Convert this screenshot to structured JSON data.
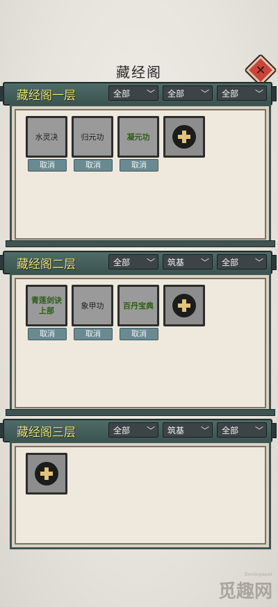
{
  "title": "藏经阁",
  "floors": [
    {
      "name": "藏经阁一层",
      "filters": [
        "全部",
        "全部",
        "全部"
      ],
      "slots": [
        {
          "name": "水灵决",
          "highlight": false
        },
        {
          "name": "归元功",
          "highlight": false
        },
        {
          "name": "凝元功",
          "highlight": true
        }
      ]
    },
    {
      "name": "藏经阁二层",
      "filters": [
        "全部",
        "筑基",
        "全部"
      ],
      "slots": [
        {
          "name": "青莲剑诀上部",
          "highlight": true
        },
        {
          "name": "象甲功",
          "highlight": false
        },
        {
          "name": "百丹宝典",
          "highlight": true
        }
      ]
    },
    {
      "name": "藏经阁三层",
      "filters": [
        "全部",
        "筑基",
        "全部"
      ],
      "slots": []
    }
  ],
  "cancel_label": "取消",
  "dropdown_icon": "chevron-down-icon",
  "add_icon": "plus-icon",
  "close_icon": "close-icon",
  "watermark": {
    "main": "觅趣网",
    "sub": "Development"
  }
}
